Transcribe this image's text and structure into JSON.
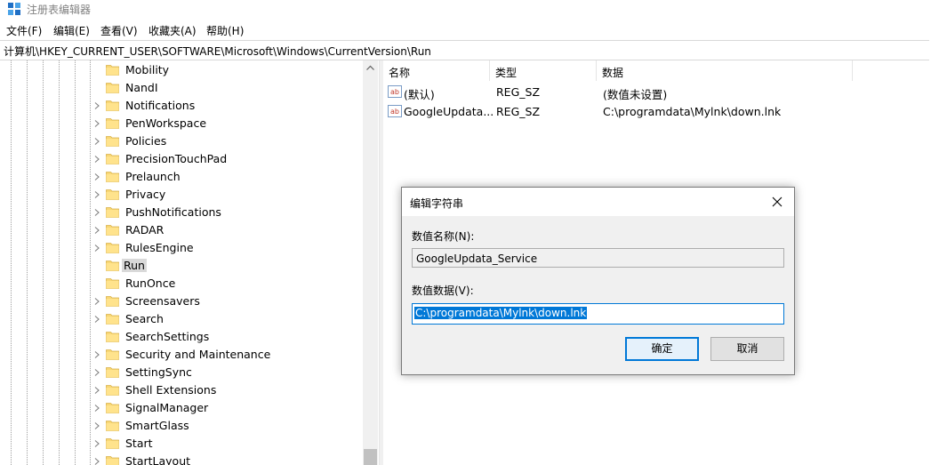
{
  "window": {
    "title": "注册表编辑器"
  },
  "menu": [
    "文件(F)",
    "编辑(E)",
    "查看(V)",
    "收藏夹(A)",
    "帮助(H)"
  ],
  "address": "计算机\\HKEY_CURRENT_USER\\SOFTWARE\\Microsoft\\Windows\\CurrentVersion\\Run",
  "tree": {
    "items": [
      {
        "label": "Mobility",
        "expandable": false
      },
      {
        "label": "NandI",
        "expandable": false
      },
      {
        "label": "Notifications",
        "expandable": true
      },
      {
        "label": "PenWorkspace",
        "expandable": true
      },
      {
        "label": "Policies",
        "expandable": true
      },
      {
        "label": "PrecisionTouchPad",
        "expandable": true
      },
      {
        "label": "Prelaunch",
        "expandable": true
      },
      {
        "label": "Privacy",
        "expandable": true
      },
      {
        "label": "PushNotifications",
        "expandable": true
      },
      {
        "label": "RADAR",
        "expandable": true
      },
      {
        "label": "RulesEngine",
        "expandable": true
      },
      {
        "label": "Run",
        "expandable": false,
        "selected": true
      },
      {
        "label": "RunOnce",
        "expandable": false
      },
      {
        "label": "Screensavers",
        "expandable": true
      },
      {
        "label": "Search",
        "expandable": true
      },
      {
        "label": "SearchSettings",
        "expandable": false
      },
      {
        "label": "Security and Maintenance",
        "expandable": true
      },
      {
        "label": "SettingSync",
        "expandable": true
      },
      {
        "label": "Shell Extensions",
        "expandable": true
      },
      {
        "label": "SignalManager",
        "expandable": true
      },
      {
        "label": "SmartGlass",
        "expandable": true
      },
      {
        "label": "Start",
        "expandable": true
      },
      {
        "label": "StartLayout",
        "expandable": true
      }
    ]
  },
  "values": {
    "headers": {
      "name": "名称",
      "type": "类型",
      "data": "数据"
    },
    "rows": [
      {
        "name": "(默认)",
        "type": "REG_SZ",
        "data": "(数值未设置)",
        "icon": "string-value-icon"
      },
      {
        "name": "GoogleUpdata...",
        "type": "REG_SZ",
        "data": "C:\\programdata\\Mylnk\\down.lnk",
        "icon": "string-value-icon"
      }
    ]
  },
  "dialog": {
    "title": "编辑字符串",
    "name_label": "数值名称(N):",
    "name_value": "GoogleUpdata_Service",
    "data_label": "数值数据(V):",
    "data_value": "C:\\programdata\\Mylnk\\down.lnk",
    "ok_label": "确定",
    "cancel_label": "取消"
  },
  "colors": {
    "accent": "#0078d7",
    "folder": "#f8d775",
    "selected": "#d9d9d9"
  }
}
